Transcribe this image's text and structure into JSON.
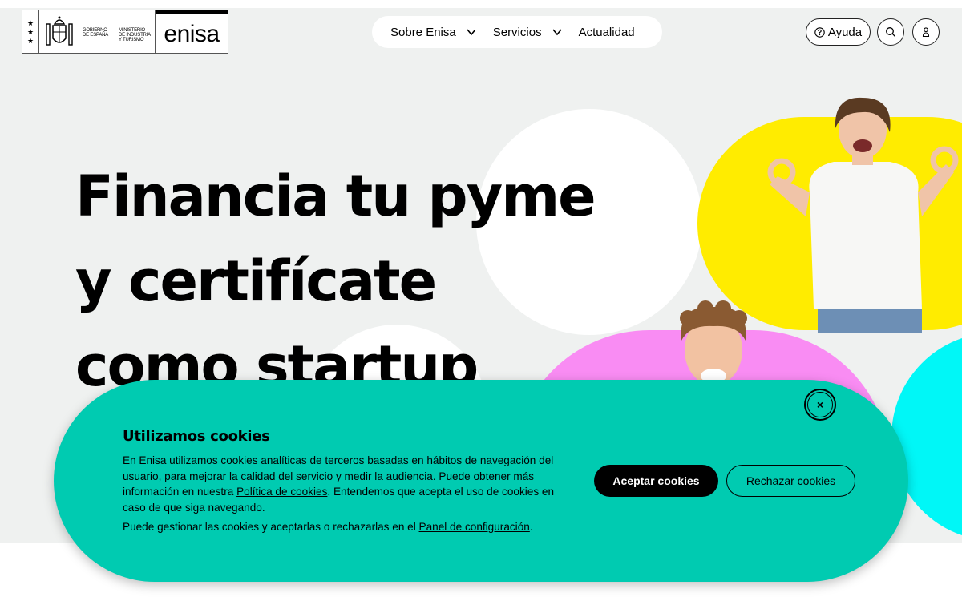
{
  "header": {
    "logo": {
      "gov_line1": "GOBIERNO",
      "gov_line2": "DE ESPAÑA",
      "min_line1": "MINISTERIO",
      "min_line2": "DE INDUSTRIA",
      "min_line3": "Y TURISMO",
      "brand": "enisa"
    },
    "nav": [
      {
        "label": "Sobre Enisa",
        "icon": "chevron-down-icon"
      },
      {
        "label": "Servicios",
        "icon": "chevron-down-icon"
      },
      {
        "label": "Actualidad"
      }
    ],
    "help_label": "Ayuda",
    "search_icon": "search-icon",
    "user_icon": "user-icon"
  },
  "hero": {
    "headline_line1": "Financia tu pyme",
    "headline_line2": "y certifícate",
    "headline_line3": "como startup"
  },
  "cookie": {
    "title": "Utilizamos cookies",
    "text_before_link": "En Enisa utilizamos cookies analíticas de terceros basadas en hábitos de navegación del usuario, para mejorar la calidad del servicio y medir la audiencia. Puede obtener más información en nuestra ",
    "policy_link": "Política de cookies",
    "text_after_link": ". Entendemos que acepta el uso de cookies en caso de que siga navegando.",
    "manage_before_link": "Puede gestionar las cookies y aceptarlas o rechazarlas en el ",
    "config_link": "Panel de configuración",
    "manage_after_link": ".",
    "accept_label": "Aceptar cookies",
    "reject_label": "Rechazar cookies",
    "close_label": "×"
  },
  "colors": {
    "hero_bg": "#eff1f0",
    "yellow": "#ffec00",
    "pink": "#f98cf3",
    "cyan": "#00f7f7",
    "cookie_bg": "#00cbb1"
  }
}
